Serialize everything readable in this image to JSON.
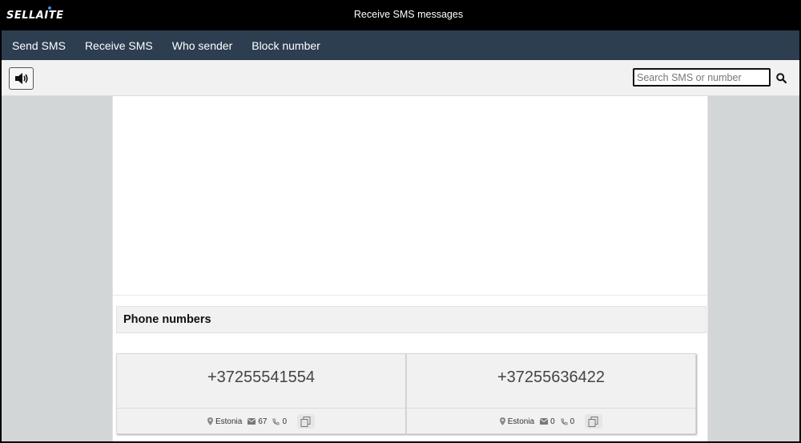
{
  "brand": {
    "logo_text": "SELLAITE"
  },
  "header": {
    "title": "Receive SMS messages"
  },
  "nav": {
    "items": [
      {
        "label": "Send SMS"
      },
      {
        "label": "Receive SMS"
      },
      {
        "label": "Who sender"
      },
      {
        "label": "Block number"
      }
    ]
  },
  "toolbar": {
    "sound_icon": "speaker-icon",
    "search": {
      "placeholder": "Search SMS or number",
      "value": ""
    },
    "search_icon": "search-icon"
  },
  "phone_section": {
    "title": "Phone numbers",
    "numbers": [
      {
        "number": "+37255541554",
        "country": "Estonia",
        "sms_count": "67",
        "call_count": "0"
      },
      {
        "number": "+37255636422",
        "country": "Estonia",
        "sms_count": "0",
        "call_count": "0"
      }
    ]
  }
}
